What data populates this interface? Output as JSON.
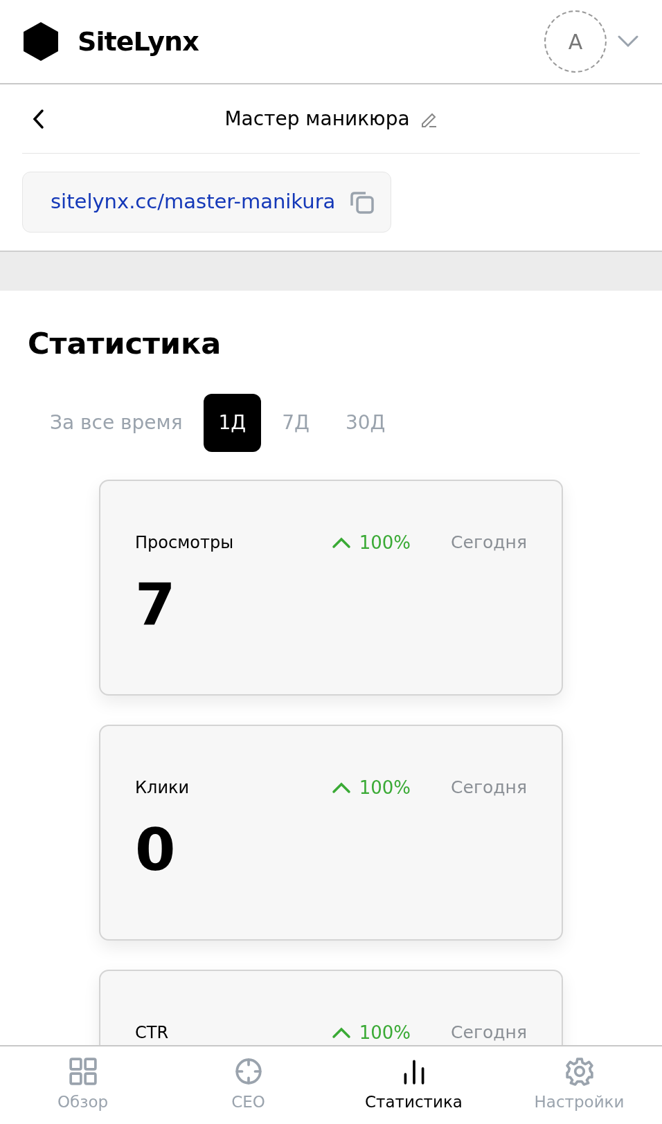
{
  "header": {
    "logo_text": "SiteLynx",
    "avatar_letter": "A"
  },
  "page": {
    "title": "Мастер маникюра",
    "link": "sitelynx.cc/master-manikura"
  },
  "stats": {
    "title": "Статистика",
    "periods": [
      {
        "label": "За все время",
        "selected": false
      },
      {
        "label": "1Д",
        "selected": true
      },
      {
        "label": "7Д",
        "selected": false
      },
      {
        "label": "30Д",
        "selected": false
      }
    ],
    "cards": [
      {
        "label": "Просмотры",
        "change": "100%",
        "kind": "increase",
        "period": "Сегодня",
        "value": "7"
      },
      {
        "label": "Клики",
        "change": "100%",
        "kind": "increase",
        "period": "Сегодня",
        "value": "0"
      },
      {
        "label": "CTR",
        "change": "100%",
        "kind": "increase",
        "period": "Сегодня"
      }
    ]
  },
  "bottom_nav": [
    {
      "label": "Обзор",
      "kind": "grid",
      "selected": false
    },
    {
      "label": "СЕО",
      "kind": "target",
      "selected": false
    },
    {
      "label": "Статистика",
      "kind": "bars",
      "selected": true
    },
    {
      "label": "Настройки",
      "kind": "gear",
      "selected": false
    }
  ]
}
